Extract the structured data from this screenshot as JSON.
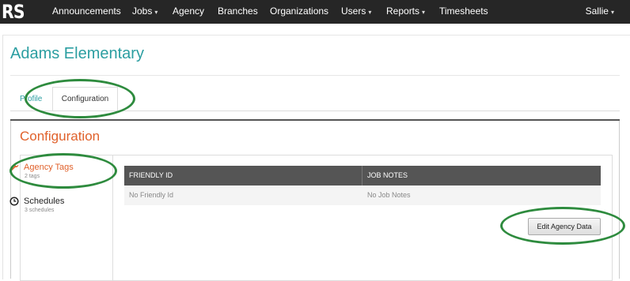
{
  "brand": {
    "logo": "RS"
  },
  "nav": {
    "items": [
      {
        "label": "Announcements",
        "dropdown": false
      },
      {
        "label": "Jobs",
        "dropdown": true
      },
      {
        "label": "Agency",
        "dropdown": false
      },
      {
        "label": "Branches",
        "dropdown": false
      },
      {
        "label": "Organizations",
        "dropdown": false
      },
      {
        "label": "Users",
        "dropdown": true
      },
      {
        "label": "Reports",
        "dropdown": true
      },
      {
        "label": "Timesheets",
        "dropdown": false
      }
    ],
    "caret": "▾",
    "user": "Sallie"
  },
  "page": {
    "title": "Adams Elementary"
  },
  "tabs": [
    {
      "label": "Profile",
      "active": false
    },
    {
      "label": "Configuration",
      "active": true
    }
  ],
  "config": {
    "title": "Configuration",
    "sidebar": [
      {
        "label": "Agency Tags",
        "sub": "2 tags",
        "icon": "wrench-icon",
        "active": true
      },
      {
        "label": "Schedules",
        "sub": "3 schedules",
        "icon": "clock-icon",
        "active": false
      }
    ],
    "table": {
      "headers": [
        "FRIENDLY ID",
        "JOB NOTES"
      ],
      "rows": [
        [
          "No Friendly Id",
          "No Job Notes"
        ]
      ]
    },
    "edit_button": "Edit Agency Data"
  },
  "colors": {
    "navbar": "#262626",
    "title": "#2b9ea1",
    "accent": "#e0612b",
    "annotation": "#2e8b3e"
  }
}
